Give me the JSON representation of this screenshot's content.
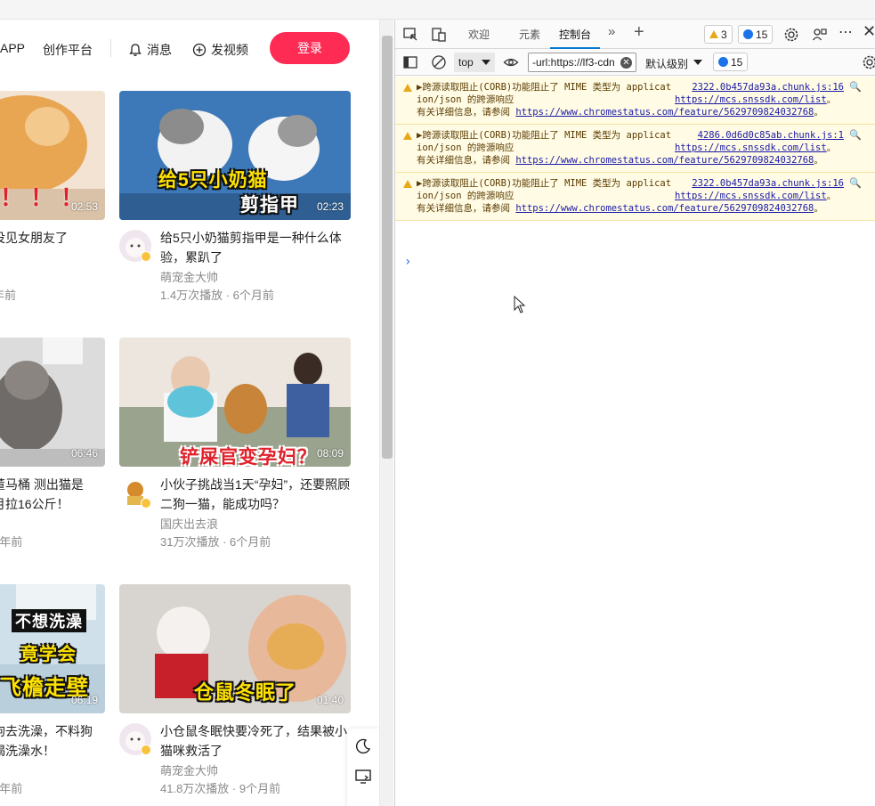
{
  "header": {
    "app_label": "APP",
    "creator_label": "创作平台",
    "messages_label": "消息",
    "post_label": "发视频",
    "login_label": "登录"
  },
  "left_cards": [
    {
      "title": "没见女朋友了",
      "meta": "年前"
    },
    {
      "title": "董马桶 测出猫是\n月拉16公斤！",
      "meta": "1年前"
    },
    {
      "title": "狗去洗澡，不料狗\n喝洗澡水！",
      "meta": "1年前"
    }
  ],
  "cards": [
    {
      "title": "给5只小奶猫剪指甲是一种什么体验，累趴了",
      "author": "萌宠金大帅",
      "meta": "1.4万次播放 · 6个月前",
      "duration": "02:23",
      "overlay1": "给5只小奶猫",
      "overlay2": "剪指甲"
    },
    {
      "title": "小伙子挑战当1天“孕妇”，还要照顾二狗一猫，能成功吗？",
      "author": "国庆出去浪",
      "meta": "31万次播放 · 6个月前",
      "duration": "08:09",
      "overlay1": "铲屎官变孕妇？",
      "overlay2": ""
    },
    {
      "title": "小仓鼠冬眠快要冷死了，结果被小猫咪救活了",
      "author": "萌宠金大帅",
      "meta": "41.8万次播放 · 9个月前",
      "duration": "01:40",
      "overlay1": "仓鼠冬眠了",
      "overlay2": ""
    }
  ],
  "left_durations": [
    "02:53",
    "06:46",
    "06:19"
  ],
  "left_overlays": {
    "bang": "！！！",
    "bath1": "不想洗澡",
    "bath2": "竟学会",
    "bath3": "飞檐走壁"
  },
  "devtools": {
    "tabs": [
      "欢迎",
      "元素",
      "控制台"
    ],
    "warning_count": "3",
    "message_count": "15",
    "context": "top",
    "filter_value": "-url:https://lf3-cdn",
    "level_label": "默认级别",
    "toolbar_message_count": "15",
    "messages": [
      {
        "source": "2322.0b457da93a.chunk.js:16",
        "lead": "▶跨源读取阻止(CORB)功能阻止了 MIME 类型为 application/json 的跨源响应",
        "link1": "https://mcs.snssdk.com/list",
        "mid": "。有关详细信息，请参阅 ",
        "link2": "https://www.chromestatus.com/feature/5629709824032768",
        "tail": "。"
      },
      {
        "source": "4286.0d6d0c85ab.chunk.js:1",
        "lead": "▶跨源读取阻止(CORB)功能阻止了 MIME 类型为 application/json 的跨源响应",
        "link1": "https://mcs.snssdk.com/list",
        "mid": "。有关详细信息，请参阅 ",
        "link2": "https://www.chromestatus.com/feature/5629709824032768",
        "tail": "。"
      },
      {
        "source": "2322.0b457da93a.chunk.js:16",
        "lead": "▶跨源读取阻止(CORB)功能阻止了 MIME 类型为 application/json 的跨源响应",
        "link1": "https://mcs.snssdk.com/list",
        "mid": "。有关详细信息，请参阅 ",
        "link2": "https://www.chromestatus.com/feature/5629709824032768",
        "tail": "。"
      }
    ],
    "prompt": "›"
  },
  "icons": {
    "bell": "bell-icon",
    "plus_circle": "plus-circle-icon",
    "moon": "moon-icon",
    "cast": "cast-icon",
    "inspect": "inspect-icon",
    "device": "device-toggle-icon",
    "more_tabs": "chevron-double-right-icon",
    "add_tab": "plus-icon",
    "settings": "gear-icon",
    "profile": "share-icon",
    "overflow": "ellipsis-icon",
    "close": "close-icon",
    "sidebar": "sidebar-icon",
    "clear": "clear-console-icon",
    "eye": "eye-icon"
  },
  "colors": {
    "accent": "#fe2c55",
    "warning_bg": "#fffbe5",
    "link": "#1a1aa6",
    "devtools_accent": "#0078d4"
  }
}
